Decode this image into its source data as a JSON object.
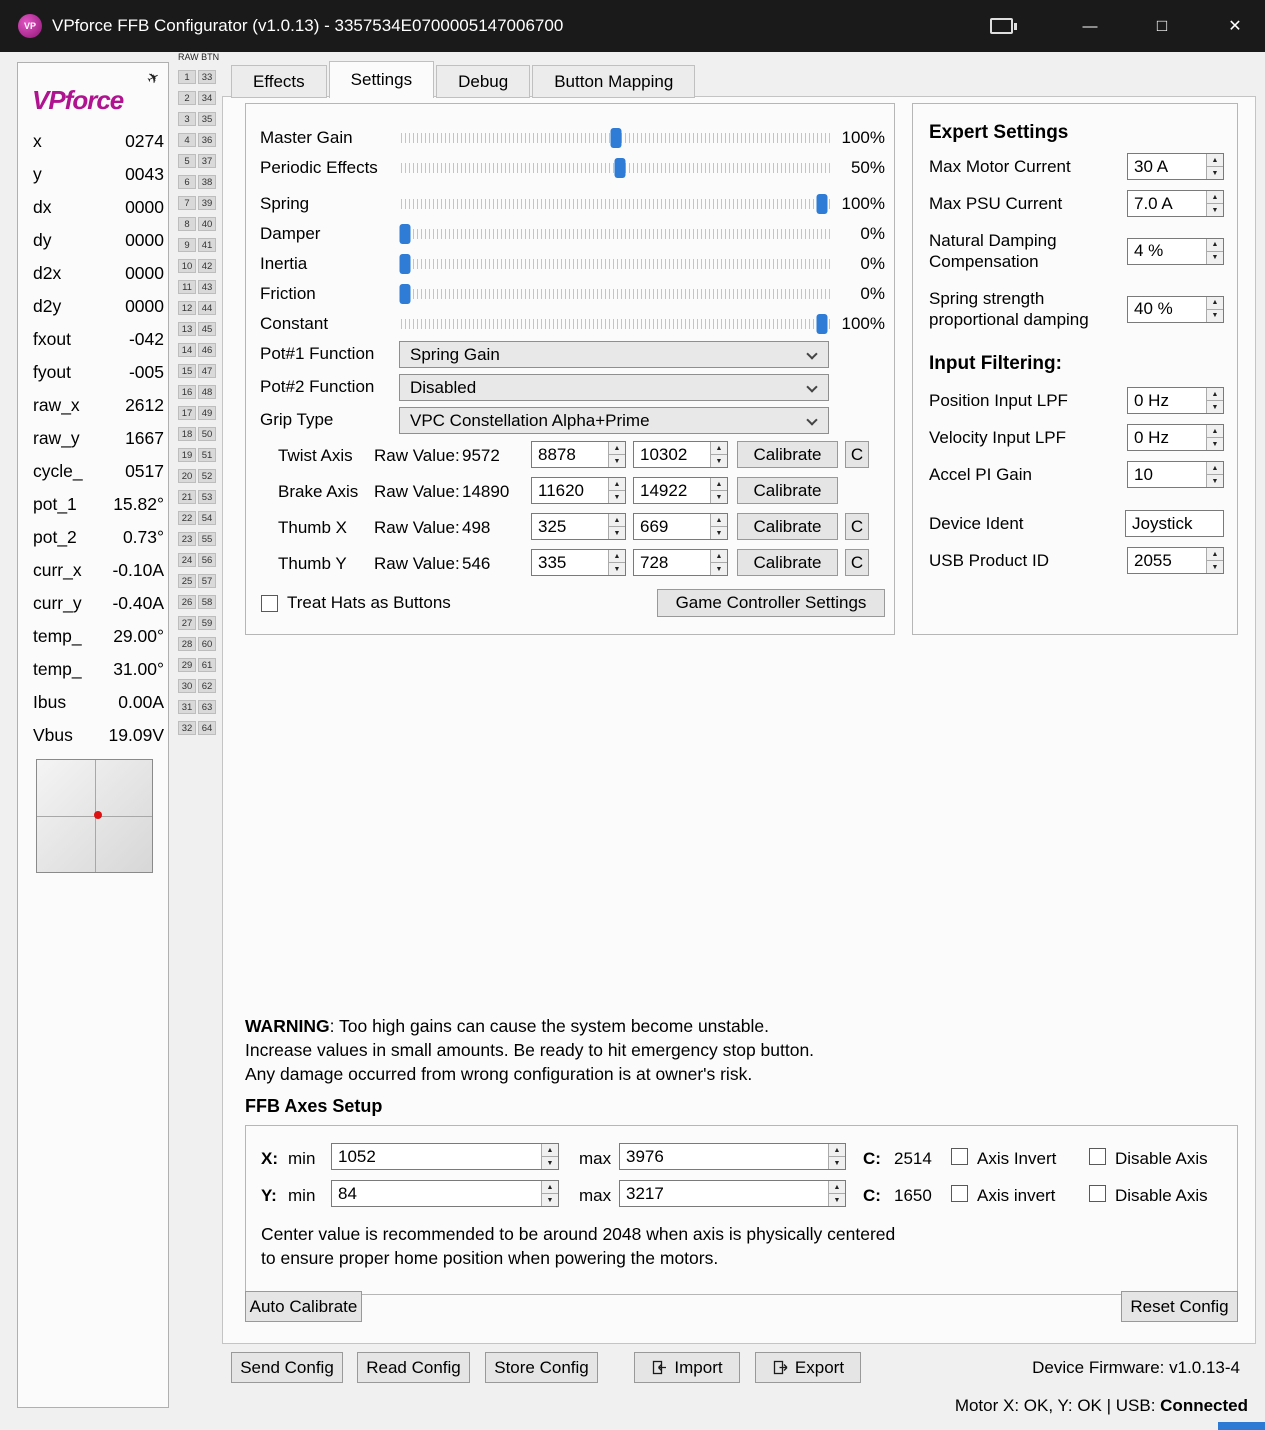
{
  "colors": {
    "accent_blue": "#2e7cd6",
    "title_bar": "#1a1a1a",
    "logo_magenta": "#b01390",
    "dot_red": "#dd1111",
    "taskbar_blue": "#2d7ad4"
  },
  "icons": {
    "app_initials": "VP",
    "plane": "✈",
    "minimize": "—",
    "maximize": "□",
    "close": "✕",
    "spin_up": "▲",
    "spin_down": "▼"
  },
  "titlebar": {
    "title": "VPforce FFB Configurator (v1.0.13) - 3357534E0700005147006700"
  },
  "sidebar": {
    "logo_text": "VPforce",
    "telemetry": [
      {
        "label": "x",
        "value": "0274"
      },
      {
        "label": "y",
        "value": "0043"
      },
      {
        "label": "dx",
        "value": "0000"
      },
      {
        "label": "dy",
        "value": "0000"
      },
      {
        "label": "d2x",
        "value": "0000"
      },
      {
        "label": "d2y",
        "value": "0000"
      },
      {
        "label": "fxout",
        "value": "-042"
      },
      {
        "label": "fyout",
        "value": "-005"
      },
      {
        "label": "raw_x",
        "value": "2612"
      },
      {
        "label": "raw_y",
        "value": "1667"
      },
      {
        "label": "cycle_",
        "value": "0517"
      },
      {
        "label": "pot_1",
        "value": "15.82°"
      },
      {
        "label": "pot_2",
        "value": "0.73°"
      },
      {
        "label": "curr_x",
        "value": "-0.10A"
      },
      {
        "label": "curr_y",
        "value": "-0.40A"
      },
      {
        "label": "temp_",
        "value": "29.00°"
      },
      {
        "label": "temp_",
        "value": "31.00°"
      },
      {
        "label": "Ibus",
        "value": "0.00A"
      },
      {
        "label": "Vbus",
        "value": "19.09V"
      }
    ]
  },
  "raw_btn": {
    "header": "RAW BTN",
    "count": 32,
    "left_start": 1,
    "right_start": 33
  },
  "tabs": [
    {
      "label": "Effects",
      "active": false
    },
    {
      "label": "Settings",
      "active": true
    },
    {
      "label": "Debug",
      "active": false
    },
    {
      "label": "Button Mapping",
      "active": false
    }
  ],
  "settings": {
    "sliders": [
      {
        "label": "Master Gain",
        "value": "100%",
        "pos": 0.5
      },
      {
        "label": "Periodic Effects",
        "value": "50%",
        "pos": 0.51
      },
      {
        "label": "Spring",
        "value": "100%",
        "pos": 0.98
      },
      {
        "label": "Damper",
        "value": "0%",
        "pos": 0.01
      },
      {
        "label": "Inertia",
        "value": "0%",
        "pos": 0.01
      },
      {
        "label": "Friction",
        "value": "0%",
        "pos": 0.01
      },
      {
        "label": "Constant",
        "value": "100%",
        "pos": 0.98
      }
    ],
    "dropdowns": [
      {
        "label": "Pot#1 Function",
        "value": "Spring Gain"
      },
      {
        "label": "Pot#2 Function",
        "value": "Disabled"
      },
      {
        "label": "Grip Type",
        "value": "VPC Constellation Alpha+Prime"
      }
    ],
    "axes": [
      {
        "name": "Twist Axis",
        "raw_label": "Raw Value:",
        "raw": "9572",
        "min": "8878",
        "max": "10302",
        "calibrate": "Calibrate",
        "c": "C"
      },
      {
        "name": "Brake Axis",
        "raw_label": "Raw Value:",
        "raw": "14890",
        "min": "11620",
        "max": "14922",
        "calibrate": "Calibrate",
        "c": null
      },
      {
        "name": "Thumb X",
        "raw_label": "Raw Value:",
        "raw": "498",
        "min": "325",
        "max": "669",
        "calibrate": "Calibrate",
        "c": "C"
      },
      {
        "name": "Thumb Y",
        "raw_label": "Raw Value:",
        "raw": "546",
        "min": "335",
        "max": "728",
        "calibrate": "Calibrate",
        "c": "C"
      }
    ],
    "treat_hats_label": "Treat Hats as Buttons",
    "game_controller_button": "Game Controller Settings"
  },
  "expert": {
    "title": "Expert Settings",
    "rows": [
      {
        "label": "Max Motor Current",
        "value": "30 A",
        "control": "spin"
      },
      {
        "label": "Max PSU Current",
        "value": "7.0 A",
        "control": "spin"
      },
      {
        "label": "Natural Damping Compensation",
        "value": "4 %",
        "control": "spin",
        "twoline": true
      },
      {
        "label": "Spring strength proportional damping",
        "value": "40 %",
        "control": "spin",
        "twoline": true
      },
      {
        "heading": "Input Filtering:"
      },
      {
        "label": "Position Input LPF",
        "value": "0 Hz",
        "control": "spin"
      },
      {
        "label": "Velocity Input LPF",
        "value": "0 Hz",
        "control": "spin"
      },
      {
        "label": "Accel PI Gain",
        "value": "10",
        "control": "spin"
      },
      {
        "spacer": true
      },
      {
        "label": "Device Ident",
        "value": "Joystick",
        "control": "text"
      },
      {
        "label": "USB Product ID",
        "value": "2055",
        "control": "spin"
      }
    ]
  },
  "warning": {
    "bold": "WARNING",
    "line1": ": Too high gains can cause the system become unstable.",
    "line2": "Increase values in small amounts. Be ready to hit emergency stop button.",
    "line3": "Any damage occurred from wrong configuration is at owner's risk."
  },
  "ffb": {
    "title": "FFB Axes Setup",
    "axes": [
      {
        "axis": "X:",
        "min_label": "min",
        "min": "1052",
        "max_label": "max",
        "max": "3976",
        "center_label": "C:",
        "center": "2514",
        "invert_label": "Axis Invert",
        "disable_label": "Disable Axis"
      },
      {
        "axis": "Y:",
        "min_label": "min",
        "min": "84",
        "max_label": "max",
        "max": "3217",
        "center_label": "C:",
        "center": "1650",
        "invert_label": "Axis invert",
        "disable_label": "Disable Axis"
      }
    ],
    "note1": "Center value is recommended to be around 2048 when axis is physically centered",
    "note2": "to ensure proper home position when powering the motors.",
    "auto_calibrate": "Auto Calibrate",
    "reset_config": "Reset Config"
  },
  "footer": {
    "buttons": [
      {
        "label": "Send Config"
      },
      {
        "label": "Read Config"
      },
      {
        "label": "Store Config"
      },
      {
        "label": "Import",
        "icon": "import-icon"
      },
      {
        "label": "Export",
        "icon": "export-icon"
      }
    ],
    "firmware": "Device Firmware:  v1.0.13-4",
    "status": {
      "left": "Motor X: OK, Y: OK | USB: ",
      "bold": "Connected"
    }
  }
}
